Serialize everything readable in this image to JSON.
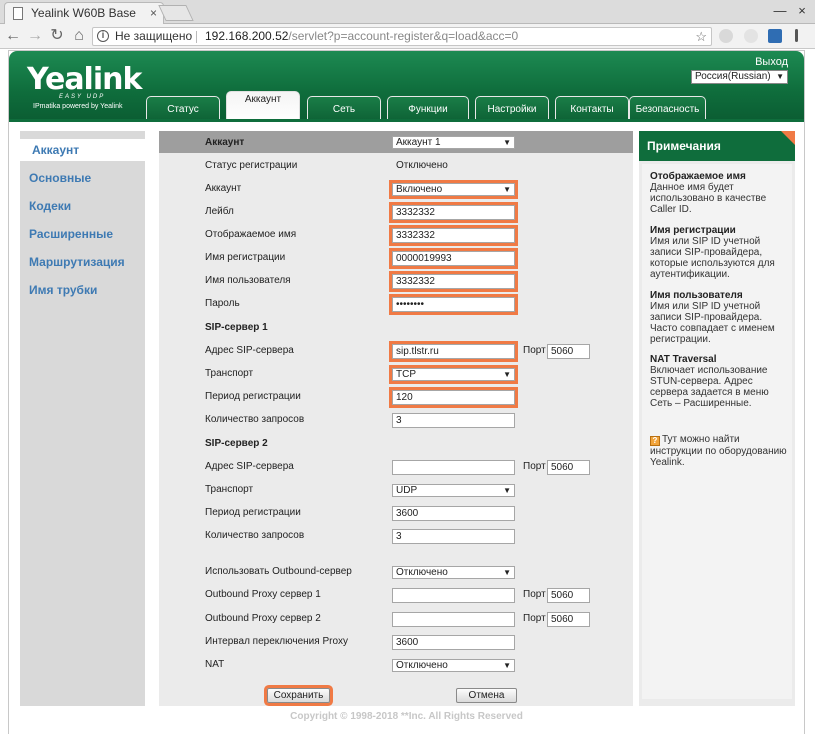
{
  "browser": {
    "tab_title": "Yealink W60B Base",
    "tab_close": "×",
    "win_min": "—",
    "win_close": "×",
    "back": "←",
    "forward": "→",
    "reload": "↻",
    "home": "⌂",
    "info_icon": "i",
    "not_secure": "Не защищено",
    "url_host": "192.168.200.52",
    "url_path": "/servlet?p=account-register&q=load&acc=0",
    "star": "☆"
  },
  "header": {
    "logo": "Yealink",
    "logo_sub": "EASY UDP",
    "logo_powered": "IPmatika powered by Yealink",
    "logout": "Выход",
    "language": "Россия(Russian)",
    "tabs": [
      {
        "label": "Статус"
      },
      {
        "label": "Аккаунт"
      },
      {
        "label": "Сеть"
      },
      {
        "label": "Функции"
      },
      {
        "label": "Настройки"
      },
      {
        "label": "Контакты"
      },
      {
        "label": "Безопасность"
      }
    ]
  },
  "leftnav": {
    "items": [
      {
        "label": "Аккаунт"
      },
      {
        "label": "Основные"
      },
      {
        "label": "Кодеки"
      },
      {
        "label": "Расширенные"
      },
      {
        "label": "Маршрутизация"
      },
      {
        "label": "Имя трубки"
      }
    ]
  },
  "form": {
    "account_label": "Аккаунт",
    "account_select": "Аккаунт 1",
    "reg_status_label": "Статус регистрации",
    "reg_status_value": "Отключено",
    "account_state_label": "Аккаунт",
    "account_state_value": "Включено",
    "label_label": "Лейбл",
    "label_value": "3332332",
    "display_name_label": "Отображаемое имя",
    "display_name_value": "3332332",
    "register_name_label": "Имя регистрации",
    "register_name_value": "0000019993",
    "username_label": "Имя пользователя",
    "username_value": "3332332",
    "password_label": "Пароль",
    "password_value": "••••••••",
    "sip1_title": "SIP-сервер 1",
    "sip1_server_label": "Адрес SIP-сервера",
    "sip1_server_value": "sip.tlstr.ru",
    "port_label": "Порт",
    "sip1_port": "5060",
    "sip1_transport_label": "Транспорт",
    "sip1_transport_value": "TCP",
    "sip1_period_label": "Период регистрации",
    "sip1_period_value": "120",
    "sip1_retries_label": "Количество запросов",
    "sip1_retries_value": "3",
    "sip2_title": "SIP-сервер 2",
    "sip2_server_label": "Адрес SIP-сервера",
    "sip2_server_value": "",
    "sip2_port": "5060",
    "sip2_transport_label": "Транспорт",
    "sip2_transport_value": "UDP",
    "sip2_period_label": "Период регистрации",
    "sip2_period_value": "3600",
    "sip2_retries_label": "Количество запросов",
    "sip2_retries_value": "3",
    "outbound_label": "Использовать Outbound-сервер",
    "outbound_value": "Отключено",
    "proxy1_label": "Outbound Proxy сервер 1",
    "proxy1_value": "",
    "proxy1_port": "5060",
    "proxy2_label": "Outbound Proxy сервер 2",
    "proxy2_value": "",
    "proxy2_port": "5060",
    "proxy_interval_label": "Интервал переключения Proxy",
    "proxy_interval_value": "3600",
    "nat_label": "NAT",
    "nat_value": "Отключено",
    "save_button": "Сохранить",
    "cancel_button": "Отмена",
    "dropdown_arrow": "▼"
  },
  "notes": {
    "title": "Примечания",
    "sections": [
      {
        "title": "Отображаемое имя",
        "text": "Данное имя будет использовано в качестве Caller ID."
      },
      {
        "title": "Имя регистрации",
        "text": "Имя или SIP ID учетной записи SIP-провайдера, которые используются для аутентификации."
      },
      {
        "title": "Имя пользователя",
        "text": "Имя или SIP ID учетной записи SIP-провайдера. Часто совпадает с именем регистрации."
      },
      {
        "title": "NAT Traversal",
        "text": "Включает использование STUN-сервера. Адрес сервера задается в меню Сеть – Расширенные."
      }
    ],
    "help_icon": "?",
    "help_text": "Тут можно найти инструкции по оборудованию Yealink."
  },
  "footer": {
    "copyright": "Copyright © 1998-2018 **Inc. All Rights Reserved"
  },
  "colors": {
    "brand_green": "#0f6d3c",
    "highlight": "#f07a45",
    "nav_link": "#3e7ab3"
  }
}
